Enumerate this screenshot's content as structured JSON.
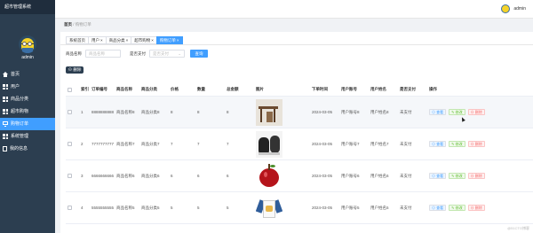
{
  "app": {
    "title": "超市管理系统",
    "admin_name": "admin"
  },
  "menu": [
    {
      "label": "首页",
      "icon": "home-icon"
    },
    {
      "label": "用户",
      "icon": "grid-icon"
    },
    {
      "label": "商品分类",
      "icon": "grid-icon"
    },
    {
      "label": "超市购物",
      "icon": "grid-icon"
    },
    {
      "label": "购物订单",
      "icon": "monitor-icon",
      "active": true
    },
    {
      "label": "系统管理",
      "icon": "grid-icon"
    },
    {
      "label": "我的信息",
      "icon": "document-icon"
    }
  ],
  "header": {
    "user_name": "admin"
  },
  "breadcrumb": {
    "home": "首页",
    "separator": "/",
    "current": "购物订单"
  },
  "tabs": [
    {
      "label": "系统首页",
      "closable": false
    },
    {
      "label": "用户",
      "closable": true
    },
    {
      "label": "商品分类",
      "closable": true
    },
    {
      "label": "超市购物",
      "closable": true
    },
    {
      "label": "购物订单",
      "closable": true,
      "active": true
    }
  ],
  "tab_close": "×",
  "search": {
    "name_label": "商品名称",
    "name_placeholder": "商品名称",
    "paid_label": "是否支付",
    "paid_placeholder": "是否支付",
    "query_button": "查询"
  },
  "toolbar": {
    "delete_label": "删除"
  },
  "table": {
    "headers": [
      "",
      "索引",
      "订单编号",
      "商品名称",
      "商品分类",
      "价格",
      "数量",
      "总金额",
      "图片",
      "下单时间",
      "用户账号",
      "用户姓名",
      "是否支付",
      "操作"
    ],
    "rows": [
      {
        "index": "1",
        "order_no": "8888888888",
        "name": "商品名称8",
        "category": "商品分类8",
        "price": "8",
        "qty": "8",
        "total": "8",
        "picture": "table",
        "time": "2024-03-05",
        "account": "用户账号8",
        "user": "用户姓名8",
        "paid": "未支付"
      },
      {
        "index": "2",
        "order_no": "7777777777",
        "name": "商品名称7",
        "category": "商品分类7",
        "price": "7",
        "qty": "7",
        "total": "7",
        "picture": "shoes",
        "time": "2024-03-05",
        "account": "用户账号7",
        "user": "用户姓名7",
        "paid": "未支付"
      },
      {
        "index": "3",
        "order_no": "6666666666",
        "name": "商品名称6",
        "category": "商品分类6",
        "price": "6",
        "qty": "6",
        "total": "6",
        "picture": "apple",
        "time": "2024-03-05",
        "account": "用户账号6",
        "user": "用户姓名6",
        "paid": "未支付"
      },
      {
        "index": "4",
        "order_no": "5555555555",
        "name": "商品名称5",
        "category": "商品分类5",
        "price": "5",
        "qty": "5",
        "total": "5",
        "picture": "shirt",
        "time": "2024-03-05",
        "account": "用户账号5",
        "user": "用户姓名5",
        "paid": "未支付"
      }
    ],
    "ops": {
      "view": "查看",
      "edit": "修改",
      "delete": "删除"
    }
  },
  "watermark": "@51CTO博客",
  "colors": {
    "sidebar": "#2c3e50",
    "primary": "#409eff",
    "danger": "#f56c6c",
    "success": "#67c23a"
  }
}
